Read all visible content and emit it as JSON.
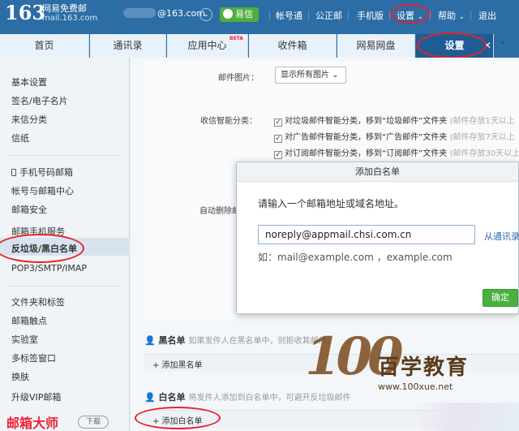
{
  "header": {
    "logo_number": "163",
    "logo_title": "网易免费邮",
    "logo_domain": "mail.163.com",
    "account_suffix": "@163.com",
    "yixin_label": "易信",
    "links": [
      "帐号通",
      "公正邮",
      "手机版",
      "设置",
      "帮助",
      "退出"
    ]
  },
  "nav": {
    "tabs": [
      "首页",
      "通讯录",
      "应用中心",
      "收件箱",
      "网易网盘",
      "设置"
    ],
    "beta_label": "BETA",
    "active_tab": "设置"
  },
  "sidebar": {
    "group1": [
      "基本设置",
      "签名/电子名片",
      "来信分类",
      "信纸"
    ],
    "group2": [
      "手机号码邮箱",
      "帐号与邮箱中心",
      "邮箱安全",
      "邮箱手机服务",
      "反垃圾/黑白名单",
      "POP3/SMTP/IMAP"
    ],
    "group3": [
      "文件夹和标签",
      "邮箱触点",
      "实验室",
      "多标签窗口",
      "换肤",
      "升级VIP邮箱"
    ],
    "active_item": "反垃圾/黑白名单",
    "bottom_promo": "邮箱大师",
    "bottom_button": "下载"
  },
  "settings": {
    "mail_images_label": "邮件图片：",
    "mail_images_value": "显示所有图片",
    "smart_sort_label": "收信智能分类：",
    "smart_sort_options": [
      {
        "text": "对垃圾邮件智能分类，移到“垃圾邮件”文件夹",
        "note": "(邮件存放1天以上"
      },
      {
        "text": "对广告邮件智能分类，移到“广告邮件”文件夹",
        "note": "(邮件存放7天以上"
      },
      {
        "text": "对订阅邮件智能分类，移到“订阅邮件”文件夹",
        "note": "(邮件存放30天以上"
      }
    ],
    "auto_delete_label": "自动删除邮",
    "blacklist": {
      "title": "黑名单",
      "desc": "如果发件人在黑名单中，则拒收其邮件。",
      "add": "+ 添加黑名单"
    },
    "whitelist": {
      "title": "白名单",
      "desc": "将发件人添加到白名单中，可避开反垃圾邮件",
      "add": "+ 添加白名单"
    }
  },
  "dialog": {
    "title": "添加白名单",
    "prompt": "请输入一个邮箱地址或域名地址。",
    "input_value": "noreply@appmail.chsi.com.cn",
    "contacts_link": "从通讯录",
    "hint": "如：mail@example.com ，example.com",
    "ok_button": "确定"
  },
  "watermark": {
    "logo": "100",
    "title": "百学教育",
    "url": "www.100xue.net"
  },
  "colors": {
    "header_blue": "#2d6da5",
    "active_tab": "#1e5c94",
    "ok_green": "#4ab03e",
    "annotation_red": "#e8202a"
  }
}
